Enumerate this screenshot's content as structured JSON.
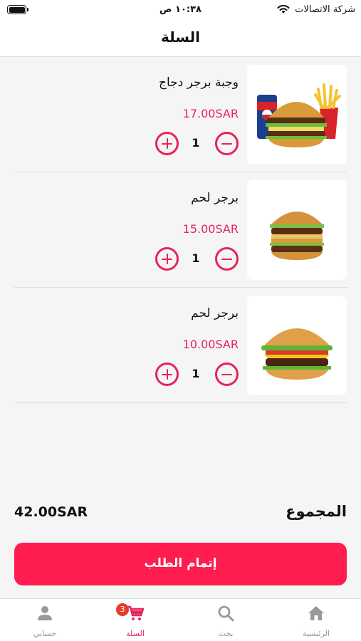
{
  "status_bar": {
    "time": "١٠:٣٨ ص",
    "carrier": "شركة الاتصالات"
  },
  "header": {
    "title": "السلة"
  },
  "cart": {
    "items": [
      {
        "name": "وجبة برجر دجاج",
        "price": "17.00SAR",
        "quantity": "1",
        "image": "burger-meal-with-fries-and-drink"
      },
      {
        "name": "برجر لحم",
        "price": "15.00SAR",
        "quantity": "1",
        "image": "double-beef-burger"
      },
      {
        "name": "برجر لحم",
        "price": "10.00SAR",
        "quantity": "1",
        "image": "cheeseburger"
      }
    ]
  },
  "summary": {
    "total_label": "المجموع",
    "total_value": "42.00SAR"
  },
  "checkout": {
    "label": "إتمام الطلب"
  },
  "tab_bar": {
    "tabs": [
      {
        "label": "الرئيسية",
        "icon": "home-icon",
        "active": false
      },
      {
        "label": "بحث",
        "icon": "search-icon",
        "active": false
      },
      {
        "label": "السلة",
        "icon": "cart-icon",
        "active": true,
        "badge": "3"
      },
      {
        "label": "حسابي",
        "icon": "user-icon",
        "active": false
      }
    ]
  },
  "colors": {
    "accent": "#e6245a",
    "button": "#ff1c4f",
    "badge": "#e63a2a",
    "background": "#f5f5f5"
  }
}
